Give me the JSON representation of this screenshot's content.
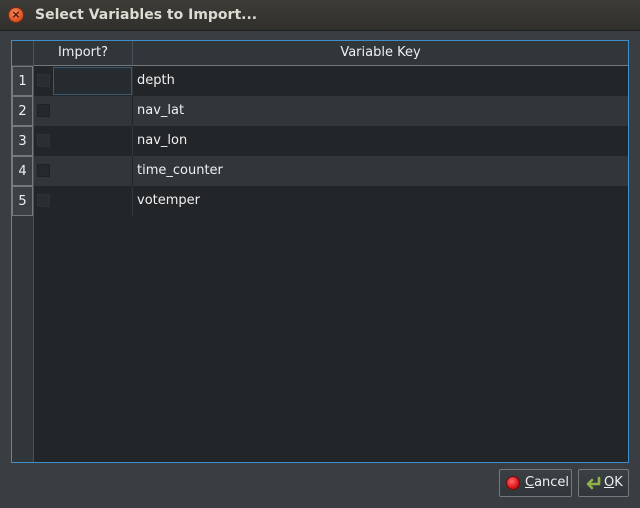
{
  "window": {
    "title": "Select Variables to Import..."
  },
  "table": {
    "columns": [
      "Import?",
      "Variable Key"
    ],
    "rows": [
      {
        "num": "1",
        "key": "depth",
        "checked": false
      },
      {
        "num": "2",
        "key": "nav_lat",
        "checked": false
      },
      {
        "num": "3",
        "key": "nav_lon",
        "checked": false
      },
      {
        "num": "4",
        "key": "time_counter",
        "checked": false
      },
      {
        "num": "5",
        "key": "votemper",
        "checked": false
      }
    ]
  },
  "buttons": {
    "cancel_mnemonic": "C",
    "cancel_rest": "ancel",
    "ok_mnemonic": "O",
    "ok_rest": "K"
  },
  "colors": {
    "accent": "#3d8ec9",
    "close": "#e2562a",
    "cancel_icon": "#e0161b",
    "ok_icon": "#8fb34a"
  },
  "icons": {
    "close": "close-icon",
    "cancel": "cancel-icon",
    "ok": "ok-icon"
  }
}
